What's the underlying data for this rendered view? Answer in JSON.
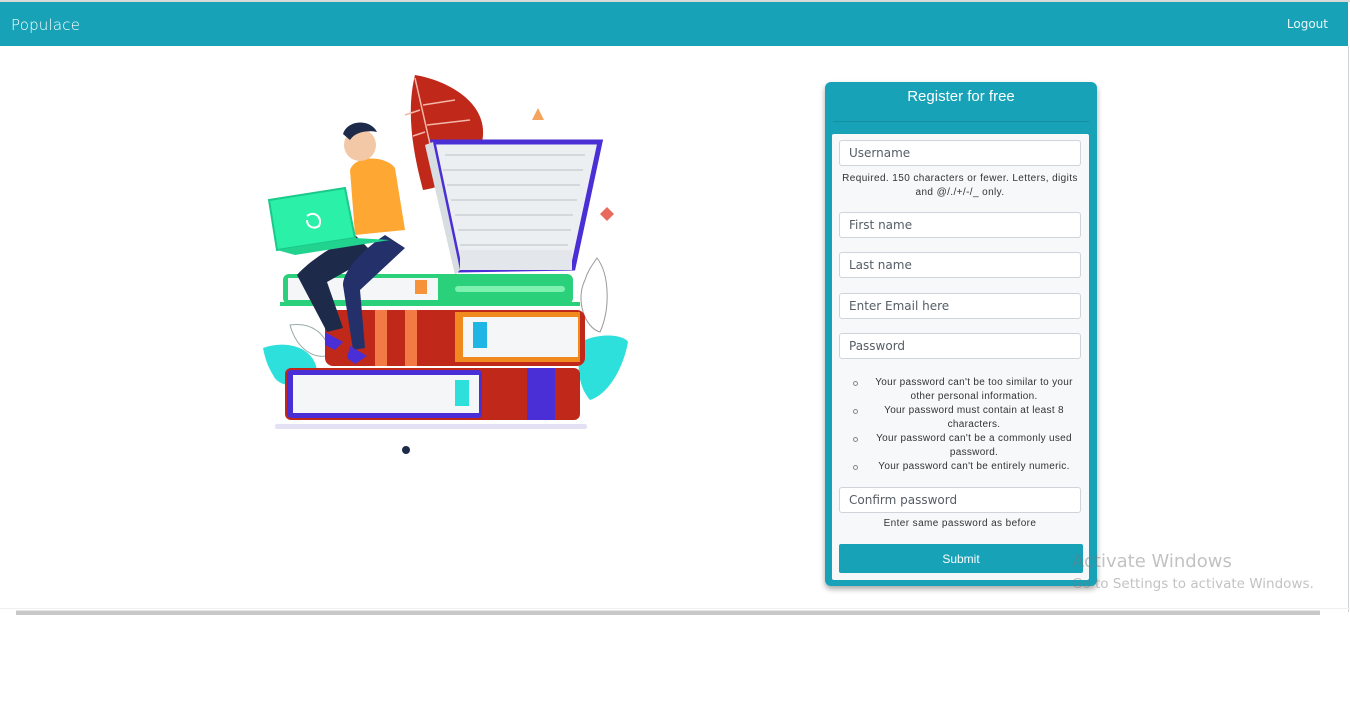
{
  "navbar": {
    "brand": "Populace",
    "logout": "Logout",
    "color": "#17a2b8"
  },
  "illustration": {
    "description_icon": "student-books-illustration"
  },
  "register": {
    "title": "Register for free",
    "username_placeholder": "Username",
    "username_help": "Required. 150 characters or fewer. Letters, digits and @/./+/-/_ only.",
    "first_name_placeholder": "First name",
    "last_name_placeholder": "Last name",
    "email_placeholder": "Enter Email here",
    "password_placeholder": "Password",
    "password_rules": [
      "Your password can't be too similar to your other personal information.",
      "Your password must contain at least 8 characters.",
      "Your password can't be a commonly used password.",
      "Your password can't be entirely numeric."
    ],
    "confirm_placeholder": "Confirm password",
    "confirm_help": "Enter same password as before",
    "submit_label": "Submit"
  },
  "watermark": {
    "title": "Activate Windows",
    "subtitle": "Go to Settings to activate Windows."
  }
}
